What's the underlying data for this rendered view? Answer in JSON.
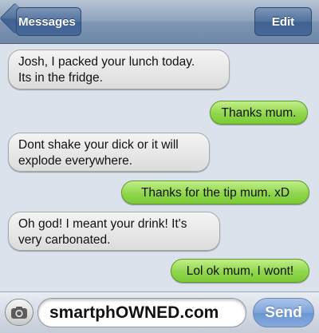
{
  "navbar": {
    "back_label": "Messages",
    "edit_label": "Edit"
  },
  "messages": [
    {
      "from": "them",
      "text": "Josh, I packed your lunch today.\nIts in the fridge."
    },
    {
      "from": "me",
      "text": "Thanks mum."
    },
    {
      "from": "them",
      "text": "Dont shake your dick or it will\nexplode everywhere."
    },
    {
      "from": "me",
      "text": "Thanks for the tip mum. xD"
    },
    {
      "from": "them",
      "text": "Oh god! I meant your drink! It's\nvery carbonated."
    },
    {
      "from": "me",
      "text": "Lol ok mum, I wont!"
    }
  ],
  "composer": {
    "input_value": "smartphOWNED.com",
    "send_label": "Send"
  },
  "colors": {
    "incoming_bubble": "#e6e6e6",
    "outgoing_bubble": "#8fd64c",
    "navbar": "#7e95b2",
    "send_button": "#7ea3d8"
  },
  "icons": [
    "camera-icon",
    "back-arrow-icon"
  ]
}
